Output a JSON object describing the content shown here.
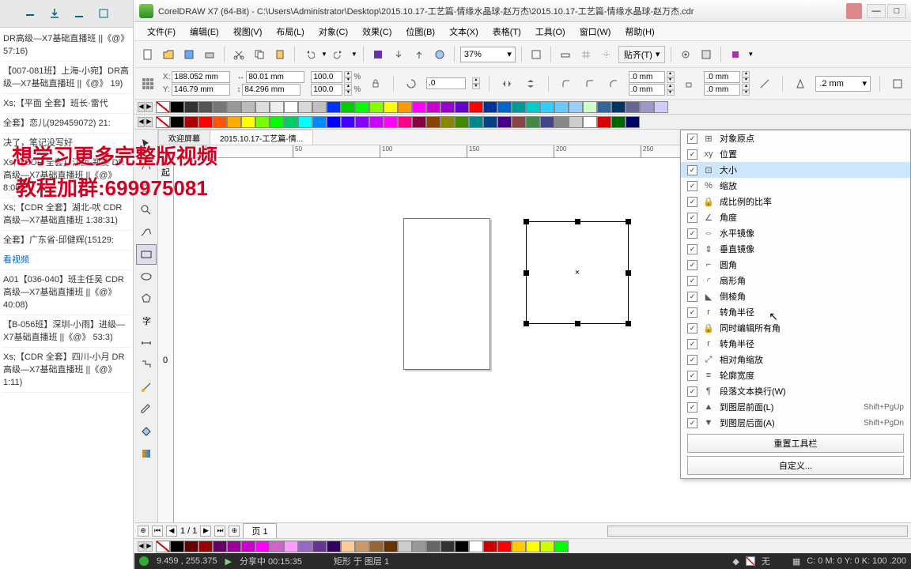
{
  "title": "CorelDRAW X7 (64-Bit) - C:\\Users\\Administrator\\Desktop\\2015.10.17-工艺篇-情缘水晶球-赵万杰\\2015.10.17-工艺篇-情缘水晶球-赵万杰.cdr",
  "menus": [
    "文件(F)",
    "编辑(E)",
    "视图(V)",
    "布局(L)",
    "对象(C)",
    "效果(C)",
    "位图(B)",
    "文本(X)",
    "表格(T)",
    "工具(O)",
    "窗口(W)",
    "帮助(H)"
  ],
  "zoom": "37%",
  "paste_label": "贴齐(T)",
  "property": {
    "x_label": "X:",
    "x_val": "188.052 mm",
    "y_label": "Y:",
    "y_val": "146.79 mm",
    "w_val": "80.01 mm",
    "h_val": "84.296 mm",
    "sx": "100.0",
    "sy": "100.0",
    "pct": "%",
    "rot": ".0",
    "dim1": ".0 mm",
    "dim2": ".0 mm",
    "dim3": ".0 mm",
    "dim4": ".0 mm",
    "dim5": ".2 mm"
  },
  "tabs": {
    "welcome": "欢迎屏幕",
    "doc": "2015.10.17-工艺篇-情..."
  },
  "ruler_ticks": [
    "0",
    "50",
    "100",
    "150",
    "200",
    "250"
  ],
  "ruler_v": "起",
  "ruler_v2": "0",
  "context_menu": [
    {
      "label": "对象原点",
      "icon": "⊞"
    },
    {
      "label": "位置",
      "icon": "xy"
    },
    {
      "label": "大小",
      "icon": "⊡",
      "hl": true
    },
    {
      "label": "缩放",
      "icon": "%"
    },
    {
      "label": "成比例的比率",
      "icon": "🔒"
    },
    {
      "label": "角度",
      "icon": "∠"
    },
    {
      "label": "水平镜像",
      "icon": "⇔"
    },
    {
      "label": "垂直镜像",
      "icon": "⇕"
    },
    {
      "label": "圆角",
      "icon": "⌐"
    },
    {
      "label": "扇形角",
      "icon": "◜"
    },
    {
      "label": "倒棱角",
      "icon": "◣"
    },
    {
      "label": "转角半径",
      "icon": "r"
    },
    {
      "label": "同时编辑所有角",
      "icon": "🔒"
    },
    {
      "label": "转角半径",
      "icon": "r"
    },
    {
      "label": "相对角缩放",
      "icon": "⤢"
    },
    {
      "label": "轮廓宽度",
      "icon": "≡"
    },
    {
      "label": "段落文本换行(W)",
      "icon": "¶"
    },
    {
      "label": "到图层前面(L)",
      "icon": "▲",
      "shortcut": "Shift+PgUp"
    },
    {
      "label": "到图层后面(A)",
      "icon": "▼",
      "shortcut": "Shift+PgDn"
    }
  ],
  "cm_buttons": {
    "reset": "重置工具栏",
    "customize": "自定义..."
  },
  "page_nav": {
    "count": "1 / 1",
    "tab": "页 1"
  },
  "status": {
    "coords": "9.459 , 255.375",
    "share": "分享中 00:15:35",
    "layer": "矩形 于 图层 1",
    "fill": "无",
    "color": "C: 0 M: 0 Y: 0 K: 100  .200"
  },
  "left_panel_items": [
    "DR高级—X7基础直播班 ||《@》 57:16)",
    "【007-081班】上海-小宛】DR高级—X7基础直播班 ||《@》 19)",
    "Xs;【平面 全套】班长·雷代",
    "全套】恋儿(929459072) 21:",
    "决了，笔记没写好",
    "Xs;【CDR 全套】江西-郑婆 DR高级—X7基础直播班 ||《@》 8:08)",
    "Xs;【CDR 全套】湖北-吠 CDR高级—X7基础直播班  1:38:31)",
    "全套】广东省-邱健辉(15129:",
    "看视频",
    "A01【036-040】班主任吴 CDR高级—X7基础直播班 ||《@》 40:08)",
    "【B-056班】深圳-小雨】进级—X7基础直播班 ||《@》 53:3)",
    "Xs;【CDR 全套】四川-小月  DR高级—X7基础直播班 ||《@》 1:11)"
  ],
  "overlay_text1": "想学习更多完整版视频",
  "overlay_text2": "教程加群:699975081",
  "palette_top": [
    "#000",
    "#333",
    "#555",
    "#777",
    "#999",
    "#bbb",
    "#ddd",
    "#eee",
    "#fff",
    "#d8d8d8",
    "#c0c0c0",
    "#03f",
    "#0c0",
    "#0f0",
    "#8f0",
    "#ff0",
    "#f90",
    "#f0f",
    "#c0c",
    "#90c",
    "#60c",
    "#f00",
    "#039",
    "#06c",
    "#099",
    "#0cc",
    "#3cf",
    "#6cf",
    "#9cf",
    "#cfc",
    "#369",
    "#036",
    "#669",
    "#99c",
    "#ccf"
  ],
  "palette_mid": [
    "#000",
    "#a00",
    "#f00",
    "#f50",
    "#fa0",
    "#ff0",
    "#7f0",
    "#0f0",
    "#0c6",
    "#0ff",
    "#08f",
    "#00f",
    "#40f",
    "#80f",
    "#c0f",
    "#f0f",
    "#f08",
    "#804",
    "#840",
    "#880",
    "#480",
    "#088",
    "#048",
    "#408",
    "#844",
    "#484",
    "#448",
    "#888",
    "#ccc",
    "#fff",
    "#d00",
    "#060",
    "#006"
  ],
  "palette_bot": [
    "#000",
    "#600",
    "#900",
    "#606",
    "#909",
    "#c0c",
    "#f0f",
    "#c6c",
    "#f9f",
    "#96c",
    "#639",
    "#306",
    "#fc9",
    "#c96",
    "#963",
    "#630",
    "#ccc",
    "#999",
    "#666",
    "#333",
    "#000",
    "#fff",
    "#c00",
    "#f00",
    "#fc0",
    "#ff0",
    "#cf0",
    "#0f0"
  ]
}
